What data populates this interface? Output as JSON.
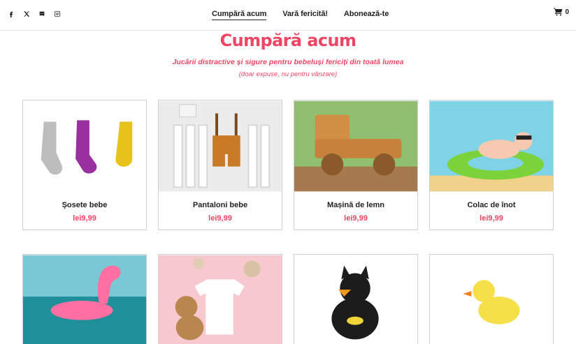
{
  "social": [
    {
      "name": "facebook-icon"
    },
    {
      "name": "x-icon"
    },
    {
      "name": "discord-icon"
    },
    {
      "name": "instagram-icon"
    }
  ],
  "nav": {
    "items": [
      {
        "label": "Cumpără acum",
        "active": true
      },
      {
        "label": "Vară fericită!"
      },
      {
        "label": "Abonează-te"
      }
    ]
  },
  "cart": {
    "count": "0"
  },
  "hero": {
    "title": "Cumpără acum",
    "subtitle": "Jucării distractive și sigure pentru bebeluși fericiți din toată lumea",
    "note": "(doar expuse, nu pentru vânzare)"
  },
  "products": [
    {
      "name": "Șosete bebe",
      "price": "lei9,99"
    },
    {
      "name": "Pantaloni bebe",
      "price": "lei9,99"
    },
    {
      "name": "Mașină de lemn",
      "price": "lei9,99"
    },
    {
      "name": "Colac de înot",
      "price": "lei9,99"
    },
    {
      "name": "",
      "price": ""
    },
    {
      "name": "",
      "price": ""
    },
    {
      "name": "",
      "price": ""
    },
    {
      "name": "",
      "price": ""
    }
  ],
  "colors": {
    "accent": "#ef4564",
    "text": "#222222",
    "border": "#cfcfcf"
  }
}
